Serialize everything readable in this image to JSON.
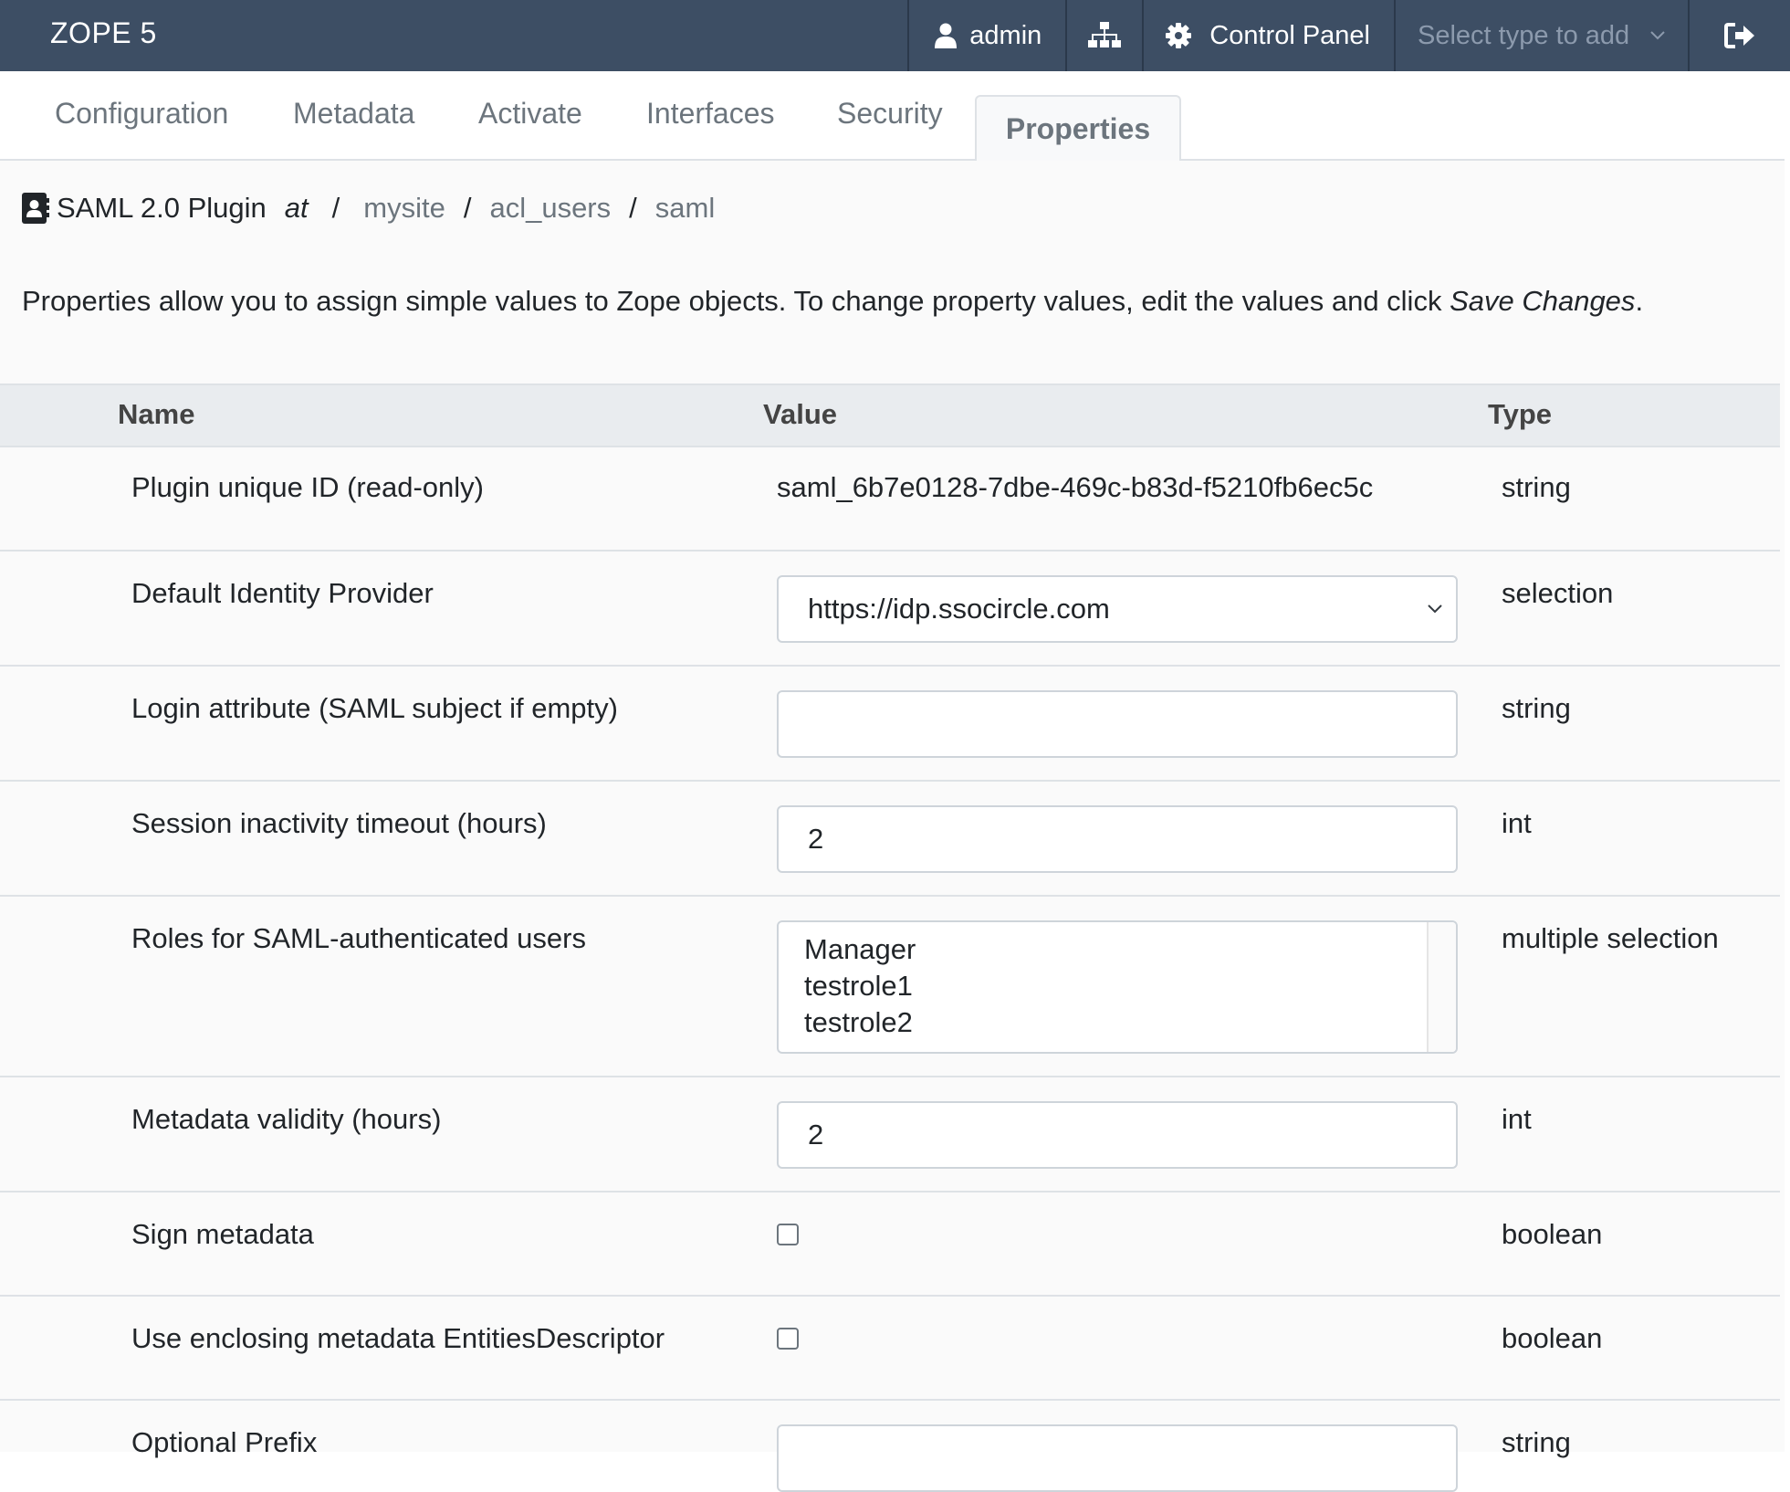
{
  "navbar": {
    "brand": "ZOPE 5",
    "user": "admin",
    "control_panel": "Control Panel",
    "select_type": "Select type to add",
    "icons": [
      "user-icon",
      "sitemap-icon",
      "gear-icon",
      "chevron-down-icon",
      "logout-icon"
    ]
  },
  "tabs": [
    "Configuration",
    "Metadata",
    "Activate",
    "Interfaces",
    "Security",
    "Properties"
  ],
  "active_tab": "Properties",
  "breadcrumb": {
    "title": "SAML 2.0 Plugin",
    "at": "at",
    "sep": "/",
    "path": [
      "mysite",
      "acl_users",
      "saml"
    ]
  },
  "intro": {
    "text": "Properties allow you to assign simple values to Zope objects. To change property values, edit the values and click ",
    "emphasis": "Save Changes",
    "end": "."
  },
  "table": {
    "headers": {
      "name": "Name",
      "value": "Value",
      "type": "Type"
    },
    "rows": [
      {
        "name": "Plugin unique ID (read-only)",
        "value": "saml_6b7e0128-7dbe-469c-b83d-f5210fb6ec5c",
        "type": "string"
      },
      {
        "name": "Default Identity Provider",
        "value": "https://idp.ssocircle.com",
        "type": "selection"
      },
      {
        "name": "Login attribute (SAML subject if empty)",
        "value": "",
        "type": "string"
      },
      {
        "name": "Session inactivity timeout (hours)",
        "value": "2",
        "type": "int"
      },
      {
        "name": "Roles for SAML-authenticated users",
        "options": [
          "Manager",
          "testrole1",
          "testrole2"
        ],
        "type": "multiple selection"
      },
      {
        "name": "Metadata validity (hours)",
        "value": "2",
        "type": "int"
      },
      {
        "name": "Sign metadata",
        "checked": false,
        "type": "boolean"
      },
      {
        "name": "Use enclosing metadata EntitiesDescriptor",
        "checked": false,
        "type": "boolean"
      },
      {
        "name": "Optional Prefix",
        "value": "",
        "type": "string"
      }
    ]
  },
  "colors": {
    "navbar": "#3d4e64",
    "header_bg": "#e9ecef",
    "border": "#dee2e6",
    "muted_text": "#6c757d"
  }
}
